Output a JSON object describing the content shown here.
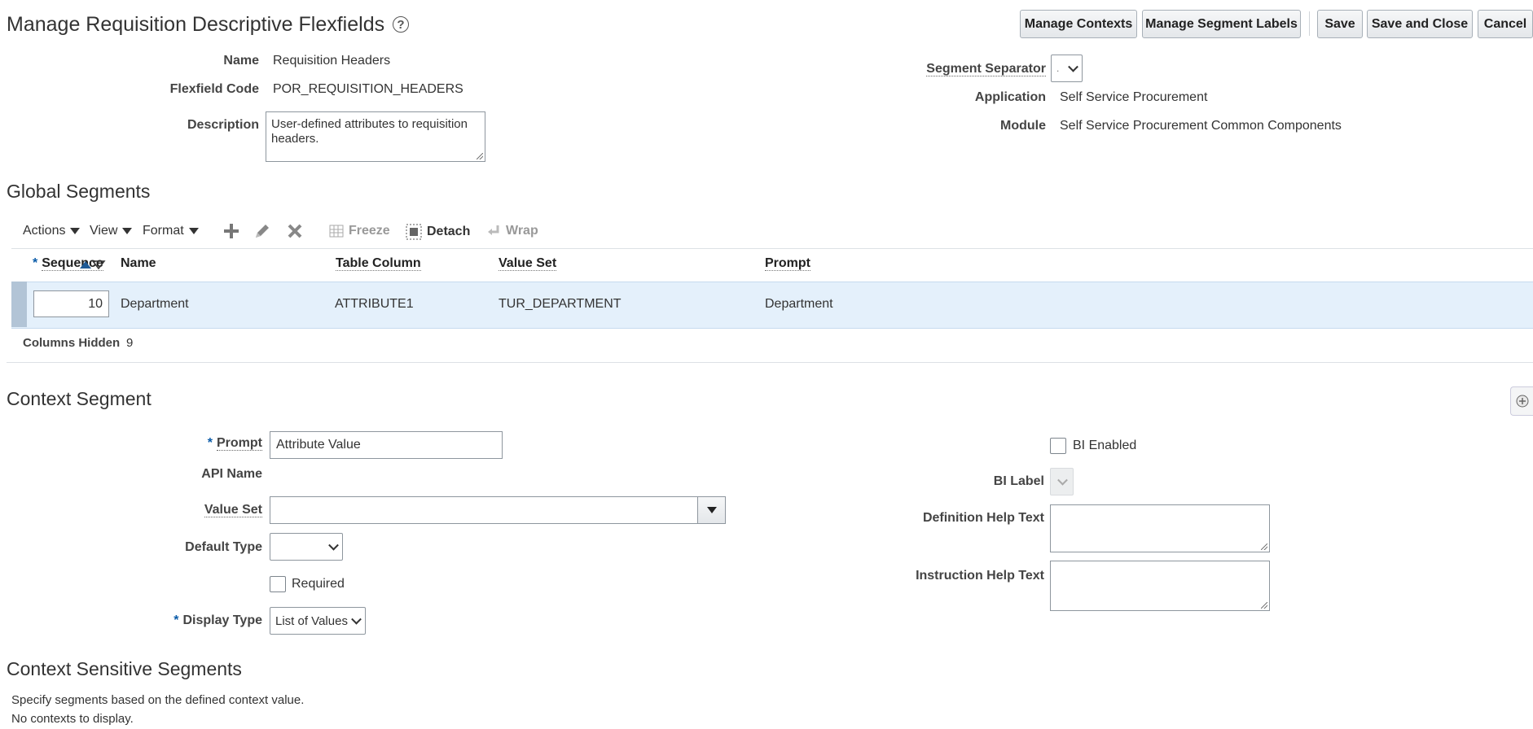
{
  "header": {
    "title": "Manage Requisition Descriptive Flexfields",
    "help_icon": "?",
    "buttons": {
      "manage_contexts": "Manage Contexts",
      "manage_segment_labels": "Manage Segment Labels",
      "save": "Save",
      "save_and_close": "Save and Close",
      "cancel": "Cancel"
    }
  },
  "details": {
    "name_label": "Name",
    "name_value": "Requisition Headers",
    "code_label": "Flexfield Code",
    "code_value": "POR_REQUISITION_HEADERS",
    "description_label": "Description",
    "description_value": "User-defined attributes to requisition headers.",
    "segment_separator_label": "Segment Separator",
    "segment_separator_value": ".",
    "application_label": "Application",
    "application_value": "Self Service Procurement",
    "module_label": "Module",
    "module_value": "Self Service Procurement Common Components"
  },
  "global_segments": {
    "title": "Global Segments",
    "toolbar": {
      "actions": "Actions",
      "view": "View",
      "format": "Format",
      "add_icon": "plus-icon",
      "edit_icon": "pencil-icon",
      "delete_icon": "x-icon",
      "freeze": "Freeze",
      "detach": "Detach",
      "wrap": "Wrap"
    },
    "columns": [
      "Sequence",
      "Name",
      "Table Column",
      "Value Set",
      "Prompt"
    ],
    "rows": [
      {
        "sequence": "10",
        "name": "Department",
        "table_column": "ATTRIBUTE1",
        "value_set": "TUR_DEPARTMENT",
        "prompt": "Department"
      }
    ],
    "columns_hidden_label": "Columns Hidden",
    "columns_hidden_value": "9"
  },
  "context_segment": {
    "title": "Context Segment",
    "prompt_label": "Prompt",
    "prompt_value": "Attribute Value",
    "api_name_label": "API Name",
    "value_set_label": "Value Set",
    "value_set_value": "",
    "default_type_label": "Default Type",
    "default_type_value": "",
    "required_label": "Required",
    "display_type_label": "Display Type",
    "display_type_value": "List of Values",
    "bi_enabled_label": "BI Enabled",
    "bi_label_label": "BI Label",
    "definition_help_label": "Definition Help Text",
    "instruction_help_label": "Instruction Help Text"
  },
  "context_sensitive": {
    "title": "Context Sensitive Segments",
    "line1": "Specify segments based on the defined context value.",
    "line2": "No contexts to display."
  }
}
